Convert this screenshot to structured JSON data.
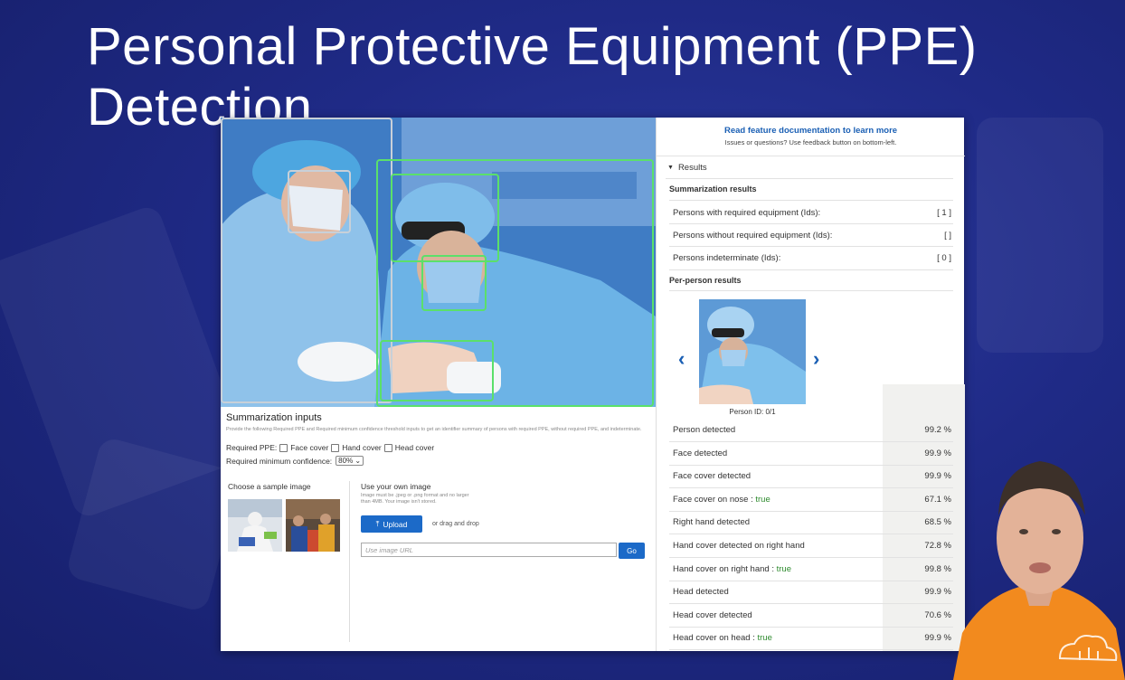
{
  "slide": {
    "title": "Personal Protective Equipment (PPE) Detection"
  },
  "inputs": {
    "heading": "Summarization inputs",
    "hint": "Provide the following Required PPE and Required minimum confidence threshold inputs to get an identifier summary of persons with required PPE, without required PPE, and indeterminate.",
    "required_ppe_label": "Required PPE:",
    "options": [
      "Face cover",
      "Hand cover",
      "Head cover"
    ],
    "min_conf_label": "Required minimum confidence:",
    "min_conf_value": "80%",
    "sample_title": "Choose a sample image",
    "own_title": "Use your own image",
    "own_hint": "Image must be .jpeg or .png format and no larger than 4MB. Your image isn't stored.",
    "upload_label": "Upload",
    "drag_text": "or drag and drop",
    "url_placeholder": "Use image URL",
    "go_label": "Go"
  },
  "results": {
    "doc_link": "Read feature documentation to learn more",
    "doc_sub": "Issues or questions? Use feedback button on bottom-left.",
    "toggle_label": "Results",
    "summary_heading": "Summarization results",
    "summary": [
      {
        "label": "Persons with required equipment (Ids):",
        "value": "[ 1 ]"
      },
      {
        "label": "Persons without required equipment (Ids):",
        "value": "[ ]"
      },
      {
        "label": "Persons indeterminate (Ids):",
        "value": "[ 0 ]"
      }
    ],
    "per_person_heading": "Per-person results",
    "person_id": "Person ID: 0/1",
    "details": [
      {
        "label": "Person detected",
        "flag": "",
        "value": "99.2 %"
      },
      {
        "label": "Face detected",
        "flag": "",
        "value": "99.9 %"
      },
      {
        "label": "Face cover detected",
        "flag": "",
        "value": "99.9 %"
      },
      {
        "label": "Face cover on nose : ",
        "flag": "true",
        "value": "67.1 %"
      },
      {
        "label": "Right hand detected",
        "flag": "",
        "value": "68.5 %"
      },
      {
        "label": "Hand cover detected on right hand",
        "flag": "",
        "value": "72.8 %"
      },
      {
        "label": "Hand cover on right hand : ",
        "flag": "true",
        "value": "99.8 %"
      },
      {
        "label": "Head detected",
        "flag": "",
        "value": "99.9 %"
      },
      {
        "label": "Head cover detected",
        "flag": "",
        "value": "70.6 %"
      },
      {
        "label": "Head cover on head : ",
        "flag": "true",
        "value": "99.9 %"
      }
    ]
  }
}
